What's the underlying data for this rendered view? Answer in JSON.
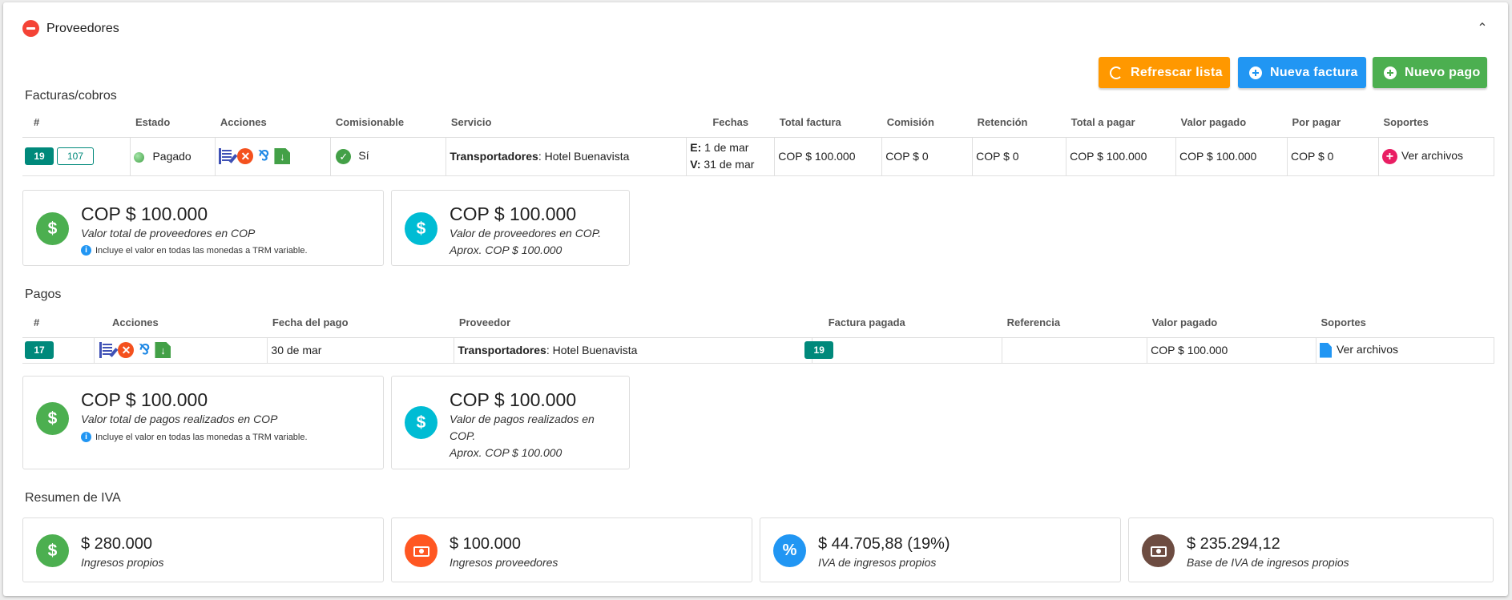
{
  "panel": {
    "title": "Proveedores",
    "collapse_icon": "chevron-up-icon"
  },
  "toolbar": {
    "refresh_label": "Refrescar lista",
    "new_invoice_label": "Nueva factura",
    "new_payment_label": "Nuevo pago"
  },
  "invoices": {
    "title": "Facturas/cobros",
    "headers": [
      "#",
      "Estado",
      "Acciones",
      "Comisionable",
      "Servicio",
      "Fechas",
      "Total factura",
      "Comisión",
      "Retención",
      "Total a pagar",
      "Valor pagado",
      "Por pagar",
      "Soportes"
    ],
    "row": {
      "id": "19",
      "ref": "107",
      "status": "Pagado",
      "commissionable": "Sí",
      "service_type": "Transportadores",
      "service_sep": ":",
      "service_name": " Hotel Buenavista",
      "date_e_label": "E:",
      "date_e": " 1 de mar",
      "date_v_label": "V:",
      "date_v": " 31 de mar",
      "total": "COP $ 100.000",
      "commission": "COP $ 0",
      "retention": "COP $ 0",
      "to_pay": "COP $ 100.000",
      "paid": "COP $ 100.000",
      "pending": "COP $ 0",
      "supports": "Ver archivos"
    },
    "cards": [
      {
        "value": "COP $ 100.000",
        "label": "Valor total de proveedores en COP",
        "note": "Incluye el valor en todas las monedas a TRM variable."
      },
      {
        "value": "COP $ 100.000",
        "label": "Valor de proveedores en COP.",
        "label2": "Aprox. COP $ 100.000"
      }
    ]
  },
  "payments": {
    "title": "Pagos",
    "headers": [
      "#",
      "Acciones",
      "Fecha del pago",
      "Proveedor",
      "Factura pagada",
      "Referencia",
      "Valor pagado",
      "Soportes"
    ],
    "row": {
      "id": "17",
      "date": "30 de mar",
      "provider_type": "Transportadores",
      "provider_sep": ":",
      "provider_name": " Hotel Buenavista",
      "invoice": "19",
      "reference": "",
      "paid": "COP $ 100.000",
      "supports": "Ver archivos"
    },
    "cards": [
      {
        "value": "COP $ 100.000",
        "label": "Valor total de pagos realizados en COP",
        "note": "Incluye el valor en todas las monedas a TRM variable."
      },
      {
        "value": "COP $ 100.000",
        "label": "Valor de pagos realizados en",
        "label1b": "COP.",
        "label2": "Aprox. COP $ 100.000"
      }
    ]
  },
  "iva": {
    "title": "Resumen de IVA",
    "cards": [
      {
        "value": "$ 280.000",
        "label": "Ingresos propios",
        "icon": "dollar-icon",
        "color": "#4caf50"
      },
      {
        "value": "$ 100.000",
        "label": "Ingresos proveedores",
        "icon": "bill-icon",
        "color": "#ff5722"
      },
      {
        "value": "$ 44.705,88 (19%)",
        "label": "IVA de ingresos propios",
        "icon": "percent-icon",
        "color": "#2196f3"
      },
      {
        "value": "$ 235.294,12",
        "label": "Base de IVA de ingresos propios",
        "icon": "bill-icon",
        "color": "#6d4c41"
      }
    ]
  }
}
